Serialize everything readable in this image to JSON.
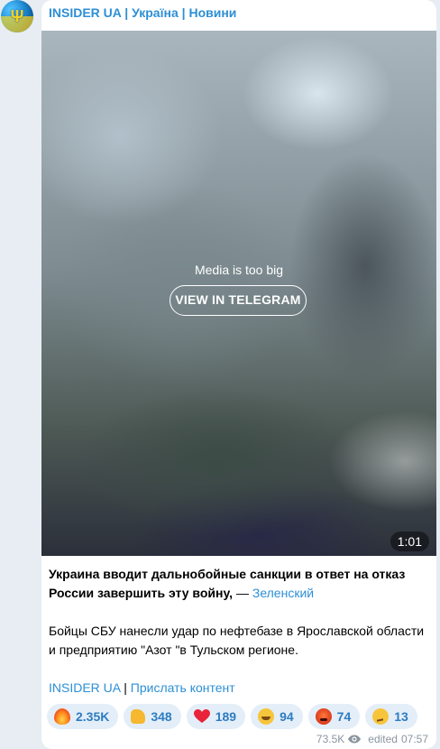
{
  "channel": {
    "title": "INSIDER UA | Україна | Новини"
  },
  "media": {
    "notice": "Media is too big",
    "button_label": "VIEW IN TELEGRAM",
    "duration": "1:01"
  },
  "message": {
    "headline": "Украина вводит дальнобойные санкции в ответ на отказ России завершить эту войну,",
    "dash": " — ",
    "quote_link": "Зеленский",
    "body": "Бойцы СБУ нанесли удар по нефтебазе в Ярославской области и предприятию \"Азот \"в Тульском регионе.",
    "footer_link_1": "INSIDER UA",
    "footer_sep": " | ",
    "footer_link_2": "Прислать контент"
  },
  "reactions": [
    {
      "icon": "fire-emoji",
      "count": "2.35K"
    },
    {
      "icon": "thumbs-up-emoji",
      "count": "348"
    },
    {
      "icon": "heart-emoji",
      "count": "189"
    },
    {
      "icon": "grinning-face-emoji",
      "count": "94"
    },
    {
      "icon": "angry-face-emoji",
      "count": "74"
    },
    {
      "icon": "thinking-face-emoji",
      "count": "13"
    }
  ],
  "meta": {
    "views": "73.5K",
    "edited": "edited",
    "time": "07:57"
  },
  "colors": {
    "link": "#2d8fd5",
    "reaction_bg": "#e4eef8",
    "page_bg": "#e7edf2"
  }
}
